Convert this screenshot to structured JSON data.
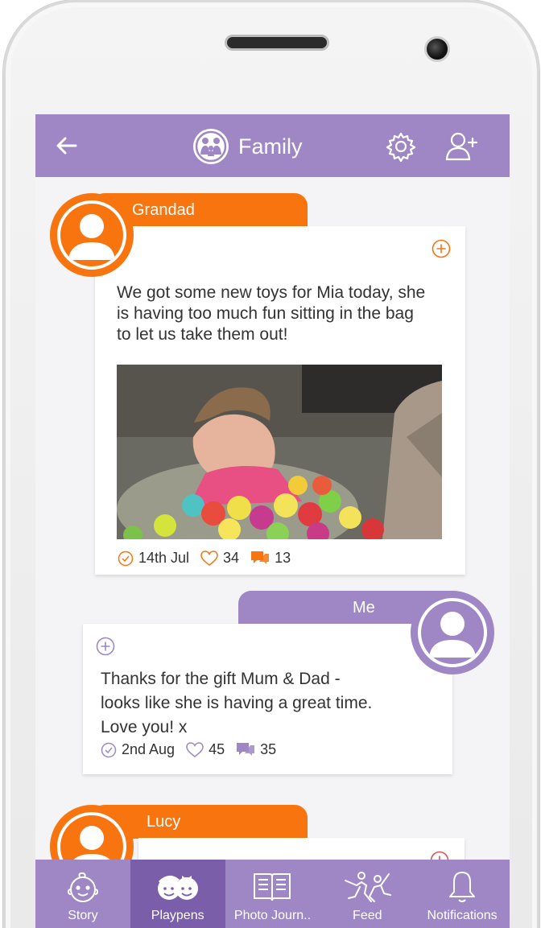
{
  "header": {
    "title": "Family",
    "back_icon": "arrow-left-icon",
    "family_icon": "family-icon",
    "settings_icon": "gear-icon",
    "add_user_icon": "add-user-icon"
  },
  "posts": [
    {
      "author": "Grandad",
      "text_lines": [
        "We got some new toys for Mia today, she",
        "is having too much fun sitting in the bag",
        "to let us take them out!"
      ],
      "date": "14th Jul",
      "likes": "34",
      "comments": "13",
      "has_photo": true,
      "accent": "#f7740f"
    },
    {
      "author": "Me",
      "text_lines": [
        "Thanks for the gift Mum & Dad -",
        "looks like she is having a great time.",
        "Love you! x"
      ],
      "date": "2nd Aug",
      "likes": "45",
      "comments": "35",
      "has_photo": false,
      "accent": "#9e87c4"
    },
    {
      "author": "Lucy",
      "accent": "#f7740f"
    }
  ],
  "nav": {
    "items": [
      {
        "label": "Story",
        "icon": "baby-face-icon"
      },
      {
        "label": "Playpens",
        "icon": "two-kids-icon"
      },
      {
        "label": "Photo Journ..",
        "icon": "open-book-icon"
      },
      {
        "label": "Feed",
        "icon": "people-jumping-icon"
      },
      {
        "label": "Notifications",
        "icon": "bell-icon"
      }
    ],
    "active": "Playpens"
  },
  "colors": {
    "brand_purple": "#9e87c4",
    "brand_purple_dark": "#7a5eaa",
    "brand_orange": "#f7740f"
  }
}
